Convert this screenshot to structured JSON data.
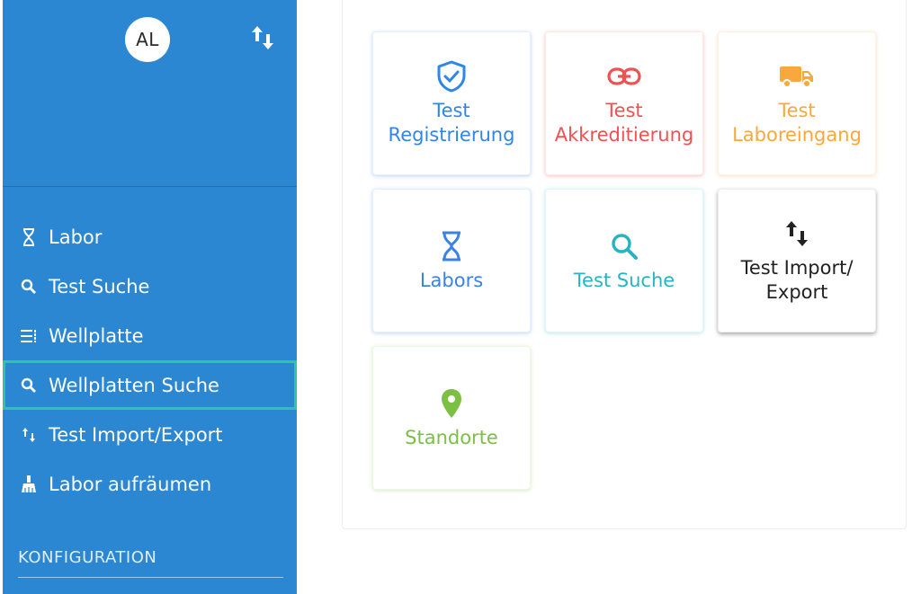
{
  "sidebar": {
    "avatar_initials": "AL",
    "swap_icon": "swap-vertical-icon",
    "nav_items": [
      {
        "label": "Labor",
        "icon": "hourglass-icon"
      },
      {
        "label": "Test Suche",
        "icon": "search-icon"
      },
      {
        "label": "Wellplatte",
        "icon": "list-icon"
      },
      {
        "label": "Wellplatten Suche",
        "icon": "search-icon",
        "active": true
      },
      {
        "label": "Test Import/Export",
        "icon": "swap-vertical-icon"
      },
      {
        "label": "Labor aufräumen",
        "icon": "broom-icon"
      }
    ],
    "section_label": "KONFIGURATION"
  },
  "tiles": [
    {
      "label": "Test Registrierung",
      "icon": "shield-check-icon",
      "color": "#2f86e8"
    },
    {
      "label": "Test Akkreditierung",
      "icon": "link-icon",
      "color": "#f05252"
    },
    {
      "label": "Test Laboreingang",
      "icon": "truck-icon",
      "color": "#f9a83c"
    },
    {
      "label": "Labors",
      "icon": "hourglass-icon",
      "color": "#3b82e6"
    },
    {
      "label": "Test Suche",
      "icon": "search-icon",
      "color": "#25b5c2"
    },
    {
      "label": "Test Import/ Export",
      "icon": "swap-vertical-icon",
      "color": "#222222"
    },
    {
      "label": "Standorte",
      "icon": "map-marker-icon",
      "color": "#7bc043"
    }
  ],
  "colors": {
    "sidebar_bg": "#2b87d2",
    "active_outline": "#34c3a0"
  }
}
